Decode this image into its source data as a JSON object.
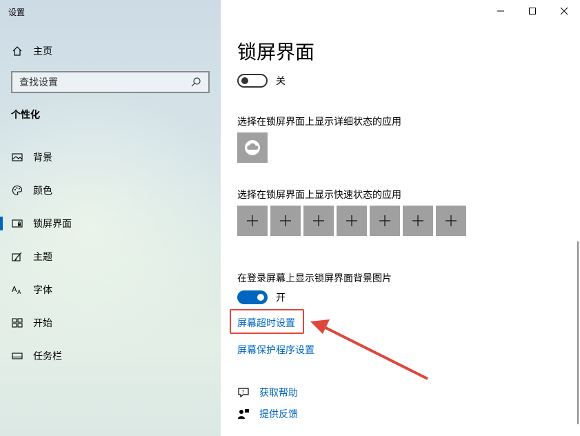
{
  "window": {
    "title": "设置",
    "minimize_glyph": "—",
    "maximize_glyph": "☐",
    "close_glyph": "✕"
  },
  "sidebar": {
    "home_label": "主页",
    "search_placeholder": "查找设置",
    "section_title": "个性化",
    "items": [
      {
        "label": "背景",
        "icon": "picture-icon",
        "active": false
      },
      {
        "label": "颜色",
        "icon": "palette-icon",
        "active": false
      },
      {
        "label": "锁屏界面",
        "icon": "lock-screen-icon",
        "active": true
      },
      {
        "label": "主题",
        "icon": "theme-brush-icon",
        "active": false
      },
      {
        "label": "字体",
        "icon": "font-icon",
        "active": false
      },
      {
        "label": "开始",
        "icon": "start-grid-icon",
        "active": false
      },
      {
        "label": "任务栏",
        "icon": "taskbar-icon",
        "active": false
      }
    ]
  },
  "main": {
    "title": "锁屏界面",
    "toggle1_state_label": "关",
    "detailed_status_label": "选择在锁屏界面上显示详细状态的应用",
    "quick_status_label": "选择在锁屏界面上显示快速状态的应用",
    "quick_status_slots": [
      "+",
      "+",
      "+",
      "+",
      "+",
      "+",
      "+"
    ],
    "signin_bg_label": "在登录屏幕上显示锁屏界面背景图片",
    "toggle2_state_label": "开",
    "screen_timeout_link": "屏幕超时设置",
    "screensaver_link": "屏幕保护程序设置",
    "get_help": "获取帮助",
    "give_feedback": "提供反馈"
  },
  "colors": {
    "accent": "#0067c0",
    "highlight_red": "#e0463b",
    "tile_gray": "#a0a0a0"
  }
}
